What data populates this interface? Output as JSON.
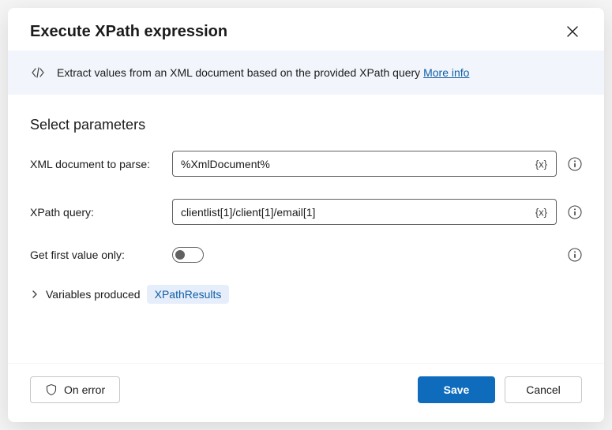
{
  "header": {
    "title": "Execute XPath expression"
  },
  "banner": {
    "text": "Extract values from an XML document based on the provided XPath query ",
    "link_label": "More info"
  },
  "section": {
    "title": "Select parameters"
  },
  "fields": {
    "xml_doc": {
      "label": "XML document to parse:",
      "value": "%XmlDocument%",
      "var_btn": "{x}"
    },
    "xpath": {
      "label": "XPath query:",
      "value": "clientlist[1]/client[1]/email[1]",
      "var_btn": "{x}"
    },
    "first_only": {
      "label": "Get first value only:",
      "state": "off"
    }
  },
  "variables": {
    "label": "Variables produced",
    "chip": "XPathResults"
  },
  "footer": {
    "on_error": "On error",
    "save": "Save",
    "cancel": "Cancel"
  }
}
